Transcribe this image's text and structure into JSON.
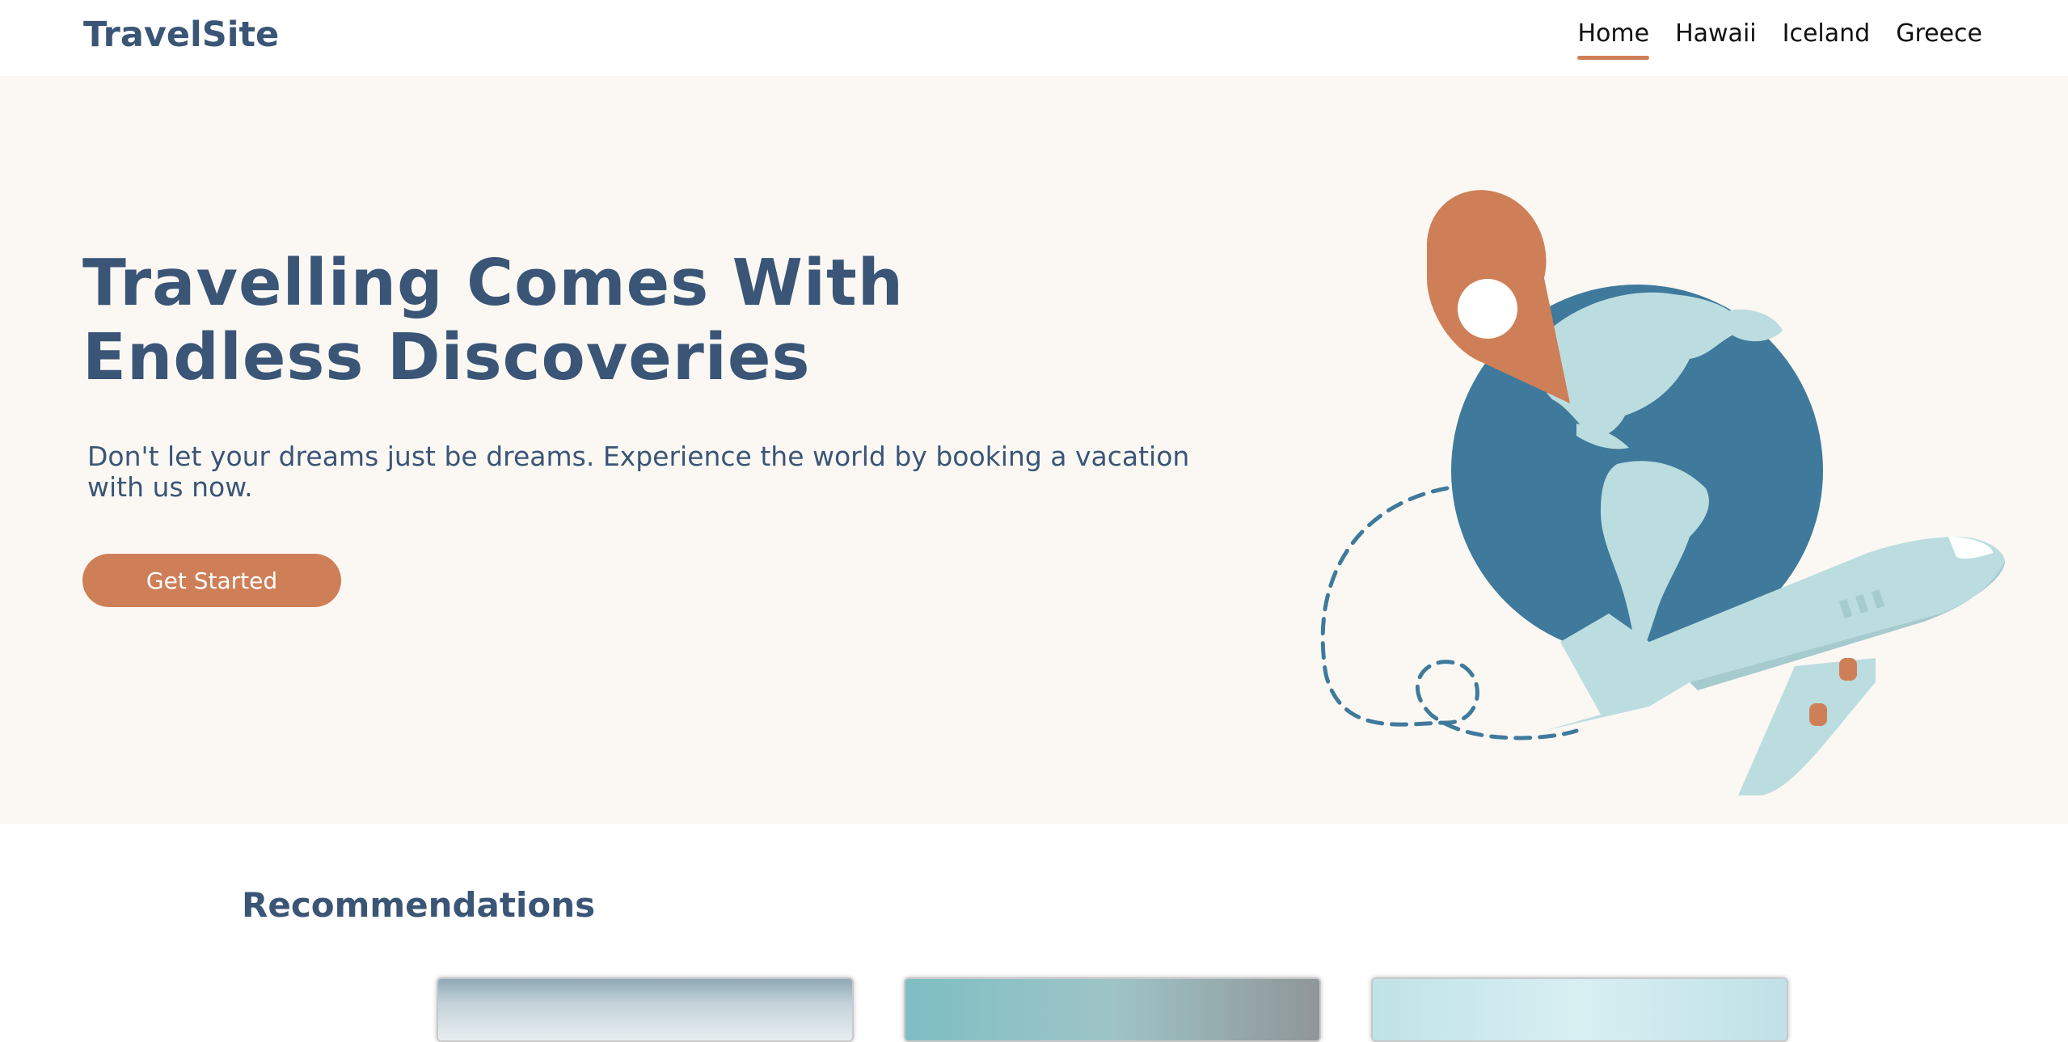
{
  "header": {
    "logo": "TravelSite",
    "nav": [
      {
        "label": "Home",
        "active": true
      },
      {
        "label": "Hawaii",
        "active": false
      },
      {
        "label": "Iceland",
        "active": false
      },
      {
        "label": "Greece",
        "active": false
      }
    ]
  },
  "hero": {
    "title_line1": "Travelling Comes With",
    "title_line2": "Endless Discoveries",
    "subtitle": "Don't let your dreams just be dreams. Experience the world by booking a vacation with us now.",
    "cta_label": "Get Started"
  },
  "recommendations": {
    "title": "Recommendations"
  },
  "colors": {
    "primary": "#3a5576",
    "accent": "#cf7f57",
    "hero_bg": "#fbf8f4",
    "globe": "#3f7a9c",
    "land": "#bcdde0"
  },
  "icons": {
    "illustration": "globe-plane-pin-illustration"
  }
}
